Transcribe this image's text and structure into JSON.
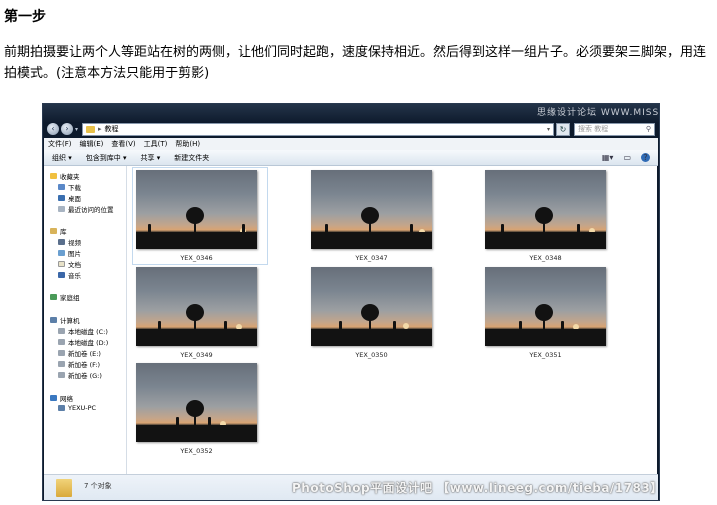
{
  "heading": "第一步",
  "paragraph": "前期拍摄要让两个人等距站在树的两侧，让他们同时起跑，速度保持相近。然后得到这样一组片子。必须要架三脚架，用连拍模式。(注意本方法只能用于剪影)",
  "explorer": {
    "top_watermark": "思缘设计论坛 WWW.MISSYUAN.COM",
    "address": {
      "path_folder": "教程"
    },
    "search_placeholder": "搜索 教程",
    "menu": [
      "文件(F)",
      "编辑(E)",
      "查看(V)",
      "工具(T)",
      "帮助(H)"
    ],
    "toolbar": {
      "organize": "组织 ▾",
      "include": "包含到库中 ▾",
      "share": "共享 ▾",
      "new_folder": "新建文件夹"
    },
    "nav": {
      "favorites": "收藏夹",
      "downloads": "下载",
      "desktop": "桌面",
      "recent": "最近访问的位置",
      "libraries": "库",
      "videos": "视频",
      "pictures": "图片",
      "documents": "文档",
      "music": "音乐",
      "homegroup": "家庭组",
      "computer": "计算机",
      "drive_c": "本地磁盘 (C:)",
      "drive_d": "本地磁盘 (D:)",
      "drive_e": "新加卷 (E:)",
      "drive_f": "新加卷 (F:)",
      "drive_g": "新加卷 (G:)",
      "network": "网络",
      "pc": "YEXU-PC"
    },
    "files": [
      "YEX_0346",
      "YEX_0347",
      "YEX_0348",
      "YEX_0349",
      "YEX_0350",
      "YEX_0351",
      "YEX_0352"
    ],
    "item_count": "7 个对象"
  },
  "bottom_watermark": "PhotoShop平面设计吧 【www.lineeg.com/tieba/1783】"
}
